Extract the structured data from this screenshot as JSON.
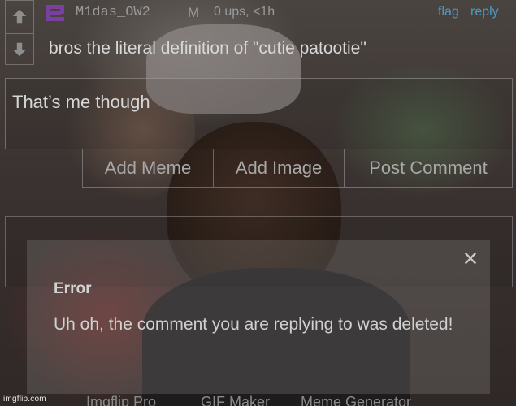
{
  "comment": {
    "username": "M1das_OW2",
    "gender": "M",
    "meta": "0 ups, <1h",
    "flag_label": "flag",
    "reply_label": "reply",
    "text": "bros the literal definition of \"cutie patootie\"",
    "upvote_icon": "arrow-up-icon",
    "downvote_icon": "arrow-down-icon",
    "avatar_icon": "user-avatar-icon"
  },
  "reply_form": {
    "value": "That’s me though",
    "add_meme_label": "Add Meme",
    "add_image_label": "Add Image",
    "post_comment_label": "Post Comment"
  },
  "footer": {
    "links": [
      "Imgflip Pro",
      "GIF Maker",
      "Meme Generator"
    ]
  },
  "error_modal": {
    "title": "Error",
    "message": "Uh oh, the comment you are replying to was deleted!",
    "close_icon": "close-icon"
  },
  "watermark": "imgflip.com",
  "colors": {
    "link": "#4c9bc4",
    "avatar": "#7a3fa0"
  }
}
